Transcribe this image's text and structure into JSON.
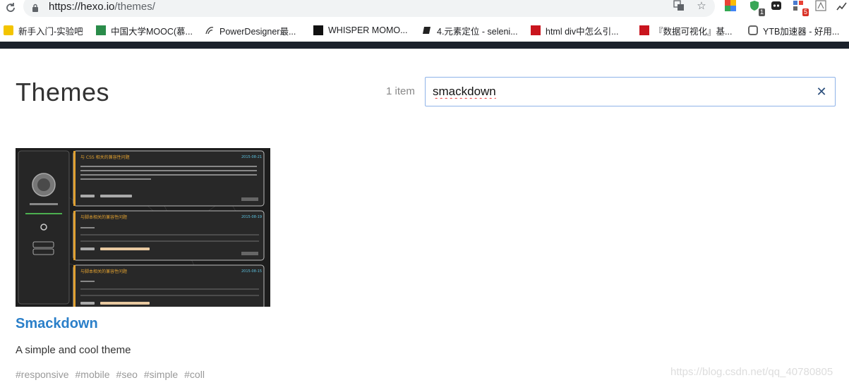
{
  "browser": {
    "url_host": "https://hexo.io",
    "url_path": "/themes/",
    "bookmarks": [
      {
        "label": "新手入门-实验吧",
        "icon": "shiyanba-icon",
        "color": "#e0a100"
      },
      {
        "label": "中国大学MOOC(慕...",
        "icon": "mooc-icon",
        "color": "#2a8c4a"
      },
      {
        "label": "PowerDesigner最...",
        "icon": "powerdesigner-icon",
        "color": "#444444"
      },
      {
        "label": "WHISPER MOMO...",
        "icon": "whisper-icon",
        "color": "#111111"
      },
      {
        "label": "4.元素定位 - seleni...",
        "icon": "book-icon",
        "color": "#222222"
      },
      {
        "label": "html div中怎么引...",
        "icon": "csdn-icon",
        "color": "#c9151e"
      },
      {
        "label": "『数据可视化』基...",
        "icon": "csdn-icon",
        "color": "#c9151e"
      },
      {
        "label": "YTB加速器 - 好用...",
        "icon": "ytb-icon",
        "color": "#666666"
      }
    ],
    "extension_badges": {
      "ext1": "1",
      "ext3": "5"
    }
  },
  "page": {
    "title": "Themes",
    "count": "1 item",
    "search": {
      "value": "smackdown",
      "placeholder": ""
    }
  },
  "results": [
    {
      "name": "Smackdown",
      "description": "A simple and cool theme",
      "tags": [
        "#responsive",
        "#mobile",
        "#seo",
        "#simple",
        "#coll"
      ],
      "preview": {
        "posts": [
          {
            "title": "与 CSS 相关的兼容性问题",
            "date": "2015-08-21"
          },
          {
            "title": "与脚本相关的兼容性问题",
            "date": "2015-08-19"
          },
          {
            "title": "与脚本相关的兼容性问题",
            "date": "2015-08-15"
          }
        ]
      }
    }
  ],
  "watermark": "https://blog.csdn.net/qq_40780805"
}
